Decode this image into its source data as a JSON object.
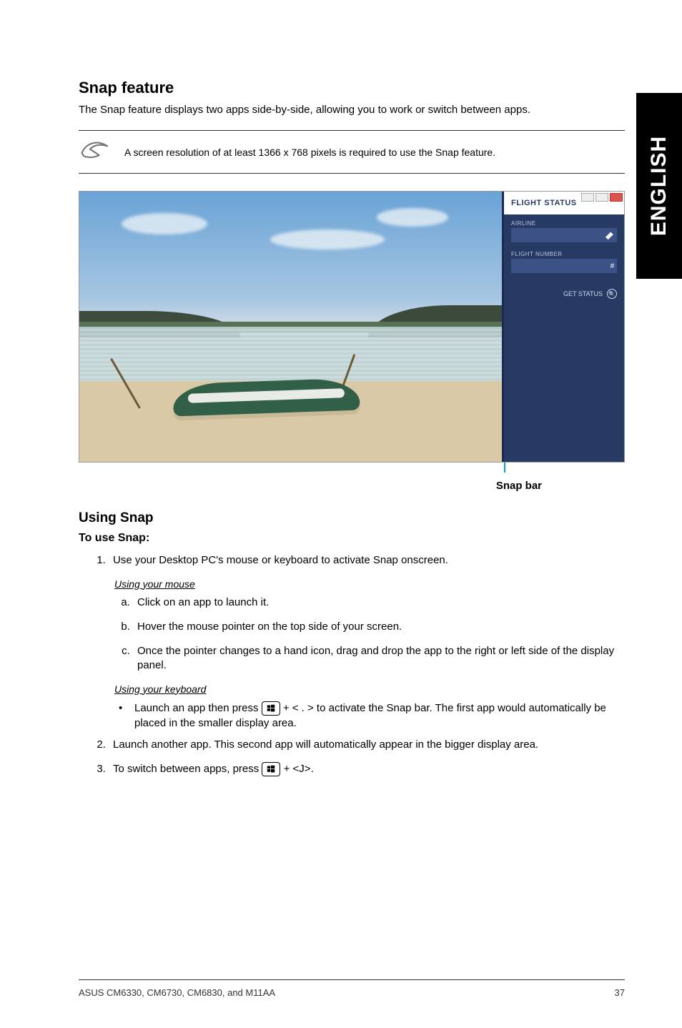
{
  "side_tab": "ENGLISH",
  "section_title": "Snap feature",
  "intro": "The Snap feature displays two apps side-by-side, allowing you to work or switch between apps.",
  "note": "A screen resolution of at least 1366 x 768 pixels is required to use the Snap feature.",
  "figure_side": {
    "title": "FLIGHT STATUS",
    "label_airline": "AIRLINE",
    "label_flight": "FLIGHT NUMBER",
    "hash": "#",
    "get_status": "GET STATUS"
  },
  "snap_bar_label": "Snap bar",
  "using_title": "Using Snap",
  "to_use": "To use Snap:",
  "step1": "Use your Desktop PC's mouse or keyboard to activate Snap onscreen.",
  "mouse_title": "Using your mouse",
  "mouse_a": "Click on an app to launch it.",
  "mouse_b": "Hover the mouse pointer on the top side of your screen.",
  "mouse_c": "Once the pointer changes to a hand icon, drag and drop the app to the right or left side of the display panel.",
  "kb_title": "Using your keyboard",
  "kb_bullet_pre": "Launch an app then press ",
  "kb_bullet_mid": " + < . > to activate the Snap bar. The first app would automatically be placed in the smaller display area.",
  "step2": "Launch another app. This second app will automatically appear in the bigger display area.",
  "step3_pre": "To switch between apps, press ",
  "step3_post": " + <J>.",
  "footer_left": "ASUS CM6330, CM6730, CM6830, and M11AA",
  "footer_right": "37"
}
